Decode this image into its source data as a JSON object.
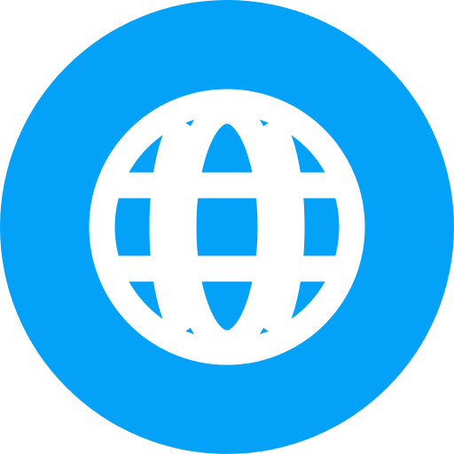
{
  "icon": {
    "name": "globe-icon",
    "background_color": "#03A1F7",
    "foreground_color": "#FFFFFF"
  }
}
